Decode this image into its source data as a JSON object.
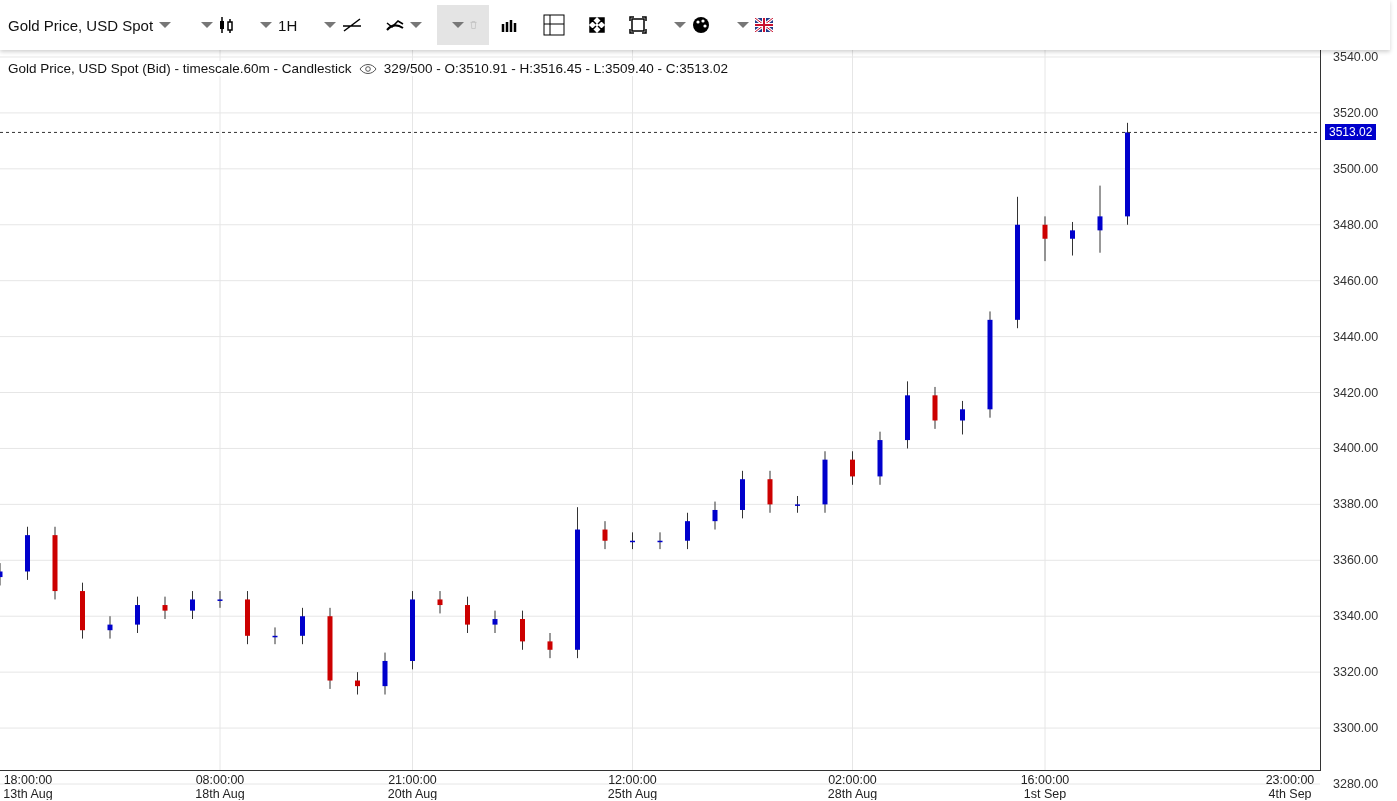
{
  "toolbar": {
    "instrument": "Gold Price, USD Spot",
    "timeframe": "1H",
    "delete_disabled": true
  },
  "chart": {
    "legend": "Gold Price, USD Spot (Bid) - timescale.60m - Candlestick",
    "ohlc": "329/500 - O:3510.91 - H:3516.45 - L:3509.40 - C:3513.02",
    "last_price": "3513.02",
    "date_labels": [
      "13th Aug",
      "18th Aug",
      "20th Aug",
      "25th Aug",
      "28th Aug",
      "1st Sep",
      "4th Sep"
    ],
    "chart_data": {
      "type": "candlestick",
      "categories": [
        null,
        "18:00:00",
        null,
        null,
        null,
        null,
        null,
        null,
        "08:00:00",
        null,
        null,
        null,
        null,
        null,
        null,
        "21:00:00",
        null,
        null,
        null,
        null,
        null,
        null,
        null,
        "12:00:00",
        null,
        null,
        null,
        null,
        null,
        null,
        null,
        "02:00:00",
        null,
        null,
        null,
        null,
        null,
        null,
        "16:00:00",
        null,
        null,
        null,
        null,
        null,
        null,
        null,
        null,
        "23:00:00"
      ],
      "ohlc": [
        [
          3354,
          3359,
          3351,
          3356
        ],
        [
          3356,
          3372,
          3353,
          3369
        ],
        [
          3369,
          3372,
          3346,
          3349
        ],
        [
          3349,
          3352,
          3332,
          3335
        ],
        [
          3335,
          3340,
          3332,
          3337
        ],
        [
          3337,
          3347,
          3334,
          3344
        ],
        [
          3344,
          3347,
          3339,
          3342
        ],
        [
          3342,
          3349,
          3339,
          3346
        ],
        [
          3346,
          3349,
          3343,
          3346
        ],
        [
          3346,
          3349,
          3330,
          3333
        ],
        [
          3333,
          3336,
          3330,
          3333
        ],
        [
          3333,
          3343,
          3330,
          3340
        ],
        [
          3340,
          3343,
          3314,
          3317
        ],
        [
          3317,
          3320,
          3312,
          3315
        ],
        [
          3315,
          3327,
          3312,
          3324
        ],
        [
          3324,
          3349,
          3321,
          3346
        ],
        [
          3346,
          3349,
          3341,
          3344
        ],
        [
          3344,
          3347,
          3334,
          3337
        ],
        [
          3337,
          3342,
          3334,
          3339
        ],
        [
          3339,
          3342,
          3328,
          3331
        ],
        [
          3331,
          3334,
          3325,
          3328
        ],
        [
          3328,
          3379,
          3325,
          3371
        ],
        [
          3371,
          3374,
          3364,
          3367
        ],
        [
          3367,
          3370,
          3364,
          3367
        ],
        [
          3367,
          3370,
          3364,
          3367
        ],
        [
          3367,
          3377,
          3364,
          3374
        ],
        [
          3374,
          3381,
          3371,
          3378
        ],
        [
          3378,
          3392,
          3375,
          3389
        ],
        [
          3389,
          3392,
          3377,
          3380
        ],
        [
          3380,
          3383,
          3377,
          3380
        ],
        [
          3380,
          3399,
          3377,
          3396
        ],
        [
          3396,
          3399,
          3387,
          3390
        ],
        [
          3390,
          3406,
          3387,
          3403
        ],
        [
          3403,
          3424,
          3400,
          3419
        ],
        [
          3419,
          3422,
          3407,
          3410
        ],
        [
          3410,
          3417,
          3405,
          3414
        ],
        [
          3414,
          3449,
          3411,
          3446
        ],
        [
          3446,
          3490,
          3443,
          3480
        ],
        [
          3480,
          3483,
          3467,
          3475
        ],
        [
          3475,
          3481,
          3469,
          3478
        ],
        [
          3478,
          3494,
          3470,
          3483
        ],
        [
          3483,
          3516.45,
          3480,
          3513.02
        ],
        null,
        null,
        null,
        null,
        null,
        null
      ],
      "ylim": [
        3280,
        3542.5
      ],
      "grid": true,
      "ref_lines": [
        {
          "axis": "y",
          "value": 3513.02
        }
      ],
      "yticks": [
        {
          "value": 3280,
          "label": "3280.00"
        },
        {
          "value": 3300,
          "label": "3300.00"
        },
        {
          "value": 3320,
          "label": "3320.00"
        },
        {
          "value": 3340,
          "label": "3340.00"
        },
        {
          "value": 3360,
          "label": "3360.00"
        },
        {
          "value": 3380,
          "label": "3380.00"
        },
        {
          "value": 3400,
          "label": "3400.00"
        },
        {
          "value": 3420,
          "label": "3420.00"
        },
        {
          "value": 3440,
          "label": "3440.00"
        },
        {
          "value": 3460,
          "label": "3460.00"
        },
        {
          "value": 3480,
          "label": "3480.00"
        },
        {
          "value": 3500,
          "label": "3500.00"
        },
        {
          "value": 3520,
          "label": "3520.00"
        },
        {
          "value": 3540,
          "label": "3540.00"
        }
      ]
    }
  }
}
